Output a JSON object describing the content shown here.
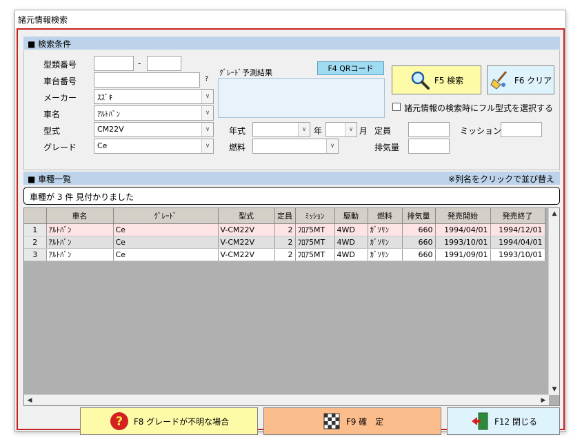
{
  "window": {
    "title": "諸元情報検索"
  },
  "search": {
    "header": "■ 検索条件",
    "type_label": "型類番号",
    "type_value1": "",
    "dash": "-",
    "type_value2": "",
    "chassis_label": "車台番号",
    "chassis_value": "",
    "question": "?",
    "maker_label": "メーカー",
    "maker_value": "ｽｽﾞｷ",
    "car_label": "車名",
    "car_value": "ｱﾙﾄﾊﾞﾝ",
    "model_label": "型式",
    "model_value": "CM22V",
    "grade_label": "グレード",
    "grade_value": "Ce",
    "grade_predict_label": "ｸﾞﾚｰﾄﾞ予測結果",
    "qr_button": "F4 QRコード",
    "year_label": "年式",
    "year_value": "",
    "year_suffix": "年",
    "month_value": "",
    "month_suffix": "月",
    "capacity_label": "定員",
    "capacity_value": "",
    "mission_label": "ミッション",
    "mission_value": "",
    "fuel_label": "燃料",
    "fuel_value": "",
    "displacement_label": "排気量",
    "displacement_value": "",
    "search_button": "F5 検索",
    "clear_button": "F6 クリア",
    "fullmodel_check_label": "諸元情報の検索時にフル型式を選択する",
    "fullmodel_checked": false
  },
  "list": {
    "header": "■ 車種一覧",
    "note": "※列名をクリックで並び替え",
    "message": "車種が 3 件 見付かりました",
    "columns": [
      "",
      "車名",
      "ｸﾞﾚｰﾄﾞ",
      "型式",
      "定員",
      "ﾐｯｼｮﾝ",
      "駆動",
      "燃料",
      "排気量",
      "発売開始",
      "発売終了"
    ],
    "rows": [
      [
        "1",
        "ｱﾙﾄﾊﾞﾝ",
        "Ce",
        "V-CM22V",
        "2",
        "ﾌﾛｱ5MT",
        "4WD",
        "ｶﾞｿﾘﾝ",
        "660",
        "1994/04/01",
        "1994/12/01"
      ],
      [
        "2",
        "ｱﾙﾄﾊﾞﾝ",
        "Ce",
        "V-CM22V",
        "2",
        "ﾌﾛｱ5MT",
        "4WD",
        "ｶﾞｿﾘﾝ",
        "660",
        "1993/10/01",
        "1994/04/01"
      ],
      [
        "3",
        "ｱﾙﾄﾊﾞﾝ",
        "Ce",
        "V-CM22V",
        "2",
        "ﾌﾛｱ5MT",
        "4WD",
        "ｶﾞｿﾘﾝ",
        "660",
        "1991/09/01",
        "1993/10/01"
      ]
    ]
  },
  "footer": {
    "grade_unknown_button": "F8 グレードが不明な場合",
    "confirm_button": "F9 確　定",
    "close_button": "F12 閉じる"
  },
  "icons": {
    "search": "magnifier-icon",
    "clear": "broom-icon",
    "help": "question-icon",
    "confirm": "checkered-flag-icon",
    "close": "exit-door-icon"
  },
  "colors": {
    "frame": "#c82020",
    "section_header": "#bcd3ea",
    "selected_row": "#fde3e3"
  }
}
